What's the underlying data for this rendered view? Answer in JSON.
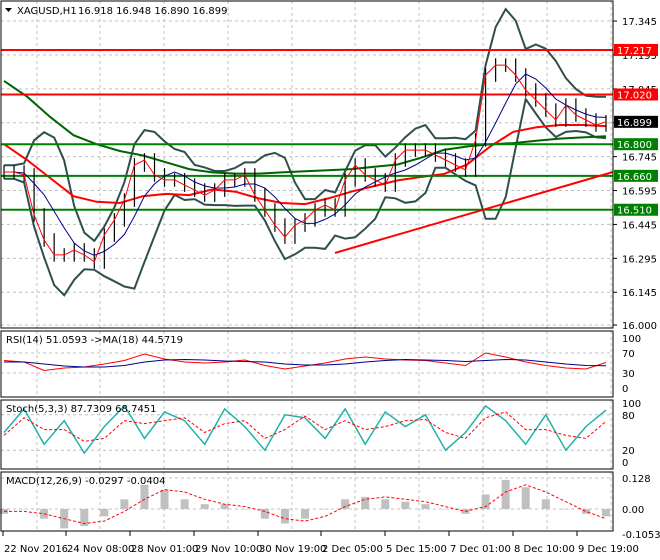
{
  "header": {
    "symbol": "XAGUSD,H1",
    "ohlc": "16.918 16.948 16.890 16.899"
  },
  "chart_data": [
    {
      "type": "line",
      "name": "price",
      "ylim": [
        16.0,
        17.4
      ],
      "y_ticks": [
        "17.345",
        "17.195",
        "17.045",
        "16.895",
        "16.745",
        "16.595",
        "16.445",
        "16.295",
        "16.145",
        "16.000"
      ],
      "x_ticks": [
        "22 Nov 2016",
        "24 Nov 08:00",
        "28 Nov 01:00",
        "29 Nov 10:00",
        "30 Nov 19:00",
        "2 Dec 05:00",
        "5 Dec 15:00",
        "7 Dec 01:00",
        "8 Dec 10:00",
        "9 Dec 19:00"
      ],
      "current_price": {
        "label": "16.899",
        "value": 16.899
      },
      "horizontal_levels": [
        {
          "label": "17.217",
          "value": 17.217,
          "color": "#ff0000"
        },
        {
          "label": "17.020",
          "value": 17.02,
          "color": "#ff0000"
        },
        {
          "label": "16.800",
          "value": 16.8,
          "color": "#008000"
        },
        {
          "label": "16.660",
          "value": 16.66,
          "color": "#008000"
        },
        {
          "label": "16.510",
          "value": 16.51,
          "color": "#008000"
        }
      ],
      "trendline": {
        "from": 16.319,
        "to": 16.677,
        "color": "#ff0000"
      },
      "close": [
        16.677,
        16.677,
        16.664,
        16.487,
        16.376,
        16.31,
        16.31,
        16.332,
        16.31,
        16.279,
        16.398,
        16.465,
        16.553,
        16.708,
        16.73,
        16.664,
        16.642,
        16.642,
        16.619,
        16.597,
        16.575,
        16.597,
        16.642,
        16.642,
        16.664,
        16.575,
        16.509,
        16.442,
        16.389,
        16.442,
        16.465,
        16.509,
        16.531,
        16.509,
        16.642,
        16.708,
        16.664,
        16.642,
        16.619,
        16.73,
        16.774,
        16.774,
        16.774,
        16.752,
        16.73,
        16.708,
        16.686,
        16.819,
        17.106,
        17.15,
        17.15,
        17.106,
        17.04,
        16.996,
        16.951,
        16.907,
        16.973,
        16.929,
        16.907,
        16.885,
        16.899
      ],
      "ma_red": [
        16.8,
        16.73,
        16.65,
        16.57,
        16.545,
        16.54,
        16.57,
        16.58,
        16.575,
        16.6,
        16.59,
        16.56,
        16.54,
        16.535,
        16.56,
        16.59,
        16.615,
        16.64,
        16.655,
        16.668,
        16.71,
        16.79,
        16.855,
        16.875,
        16.885,
        16.885,
        16.88
      ],
      "ma_green": [
        17.08,
        17.01,
        16.92,
        16.84,
        16.8,
        16.77,
        16.75,
        16.72,
        16.69,
        16.675,
        16.67,
        16.67,
        16.675,
        16.68,
        16.685,
        16.69,
        16.7,
        16.71,
        16.74,
        16.775,
        16.79,
        16.8,
        16.805,
        16.815,
        16.825,
        16.83,
        16.835
      ]
    },
    {
      "type": "line",
      "name": "rsi",
      "title": "RSI(14) 51.0593  ->MA(18) 44.5719",
      "ylim": [
        0,
        100
      ],
      "y_ticks": [
        "100",
        "70",
        "30",
        "0"
      ],
      "rsi": [
        55,
        52,
        35,
        40,
        42,
        48,
        55,
        68,
        58,
        52,
        50,
        52,
        56,
        45,
        38,
        44,
        50,
        58,
        62,
        58,
        56,
        55,
        50,
        45,
        70,
        62,
        52,
        45,
        40,
        38,
        51
      ],
      "ma": [
        52,
        52,
        48,
        44,
        42,
        42,
        45,
        52,
        56,
        57,
        56,
        54,
        53,
        52,
        48,
        46,
        46,
        48,
        52,
        55,
        57,
        56,
        55,
        53,
        55,
        57,
        56,
        52,
        48,
        45,
        44.6
      ]
    },
    {
      "type": "line",
      "name": "stochastic",
      "title": "Stoch(5,3,3) 87.7309 68.7451",
      "ylim": [
        0,
        100
      ],
      "y_ticks": [
        "100",
        "80",
        "20",
        "0"
      ],
      "k": [
        50,
        90,
        30,
        70,
        15,
        60,
        95,
        40,
        85,
        70,
        30,
        90,
        60,
        20,
        80,
        75,
        40,
        90,
        30,
        85,
        60,
        80,
        20,
        50,
        95,
        70,
        30,
        80,
        20,
        60,
        88
      ],
      "d": [
        45,
        75,
        55,
        55,
        35,
        40,
        70,
        65,
        70,
        75,
        50,
        65,
        70,
        40,
        55,
        78,
        55,
        70,
        55,
        60,
        70,
        72,
        50,
        40,
        75,
        85,
        55,
        55,
        45,
        40,
        69
      ]
    },
    {
      "type": "bar",
      "name": "macd",
      "title": "MACD(12,26,9) -0.0297 -0.0404",
      "ylim": [
        -0.1053,
        0.128
      ],
      "y_ticks": [
        "0.128",
        "0.00",
        "-0.1053"
      ],
      "histogram": [
        -0.02,
        0.0,
        -0.04,
        -0.08,
        -0.07,
        -0.03,
        0.04,
        0.1,
        0.08,
        0.04,
        0.02,
        0.02,
        0.0,
        -0.04,
        -0.06,
        -0.04,
        0.0,
        0.04,
        0.05,
        0.04,
        0.03,
        0.02,
        0.0,
        -0.02,
        0.06,
        0.12,
        0.09,
        0.04,
        0.0,
        -0.02,
        -0.03
      ],
      "signal": [
        -0.01,
        -0.01,
        -0.02,
        -0.04,
        -0.06,
        -0.05,
        -0.01,
        0.04,
        0.08,
        0.07,
        0.04,
        0.02,
        0.01,
        -0.01,
        -0.04,
        -0.05,
        -0.03,
        0.01,
        0.04,
        0.05,
        0.04,
        0.03,
        0.01,
        -0.01,
        0.01,
        0.07,
        0.1,
        0.07,
        0.03,
        -0.01,
        -0.04
      ]
    }
  ]
}
